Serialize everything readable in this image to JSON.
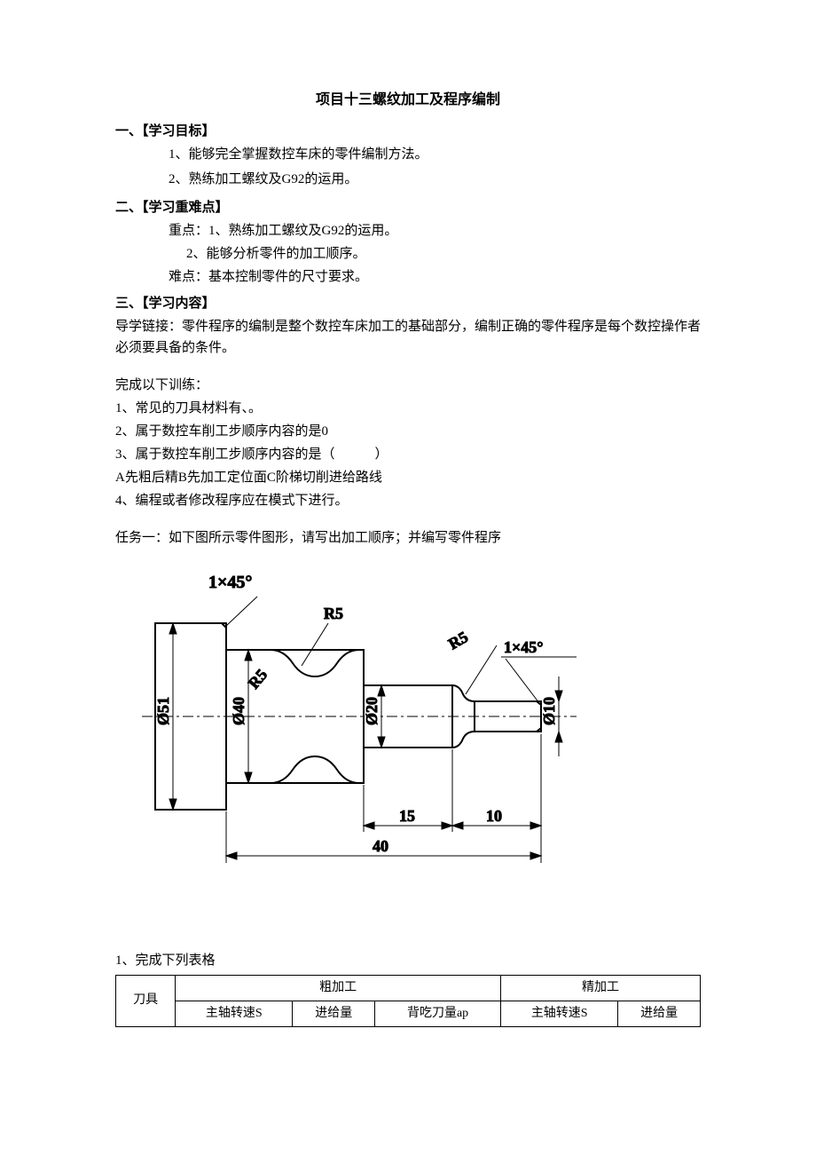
{
  "title": "项目十三螺纹加工及程序编制",
  "s1": {
    "heading": "一、【学习目标】",
    "l1": "1、能够完全掌握数控车床的零件编制方法。",
    "l2": "2、熟练加工螺纹及G92的运用。"
  },
  "s2": {
    "heading": "二、【学习重难点】",
    "l1": "重点：1、熟练加工螺纹及G92的运用。",
    "l2": "2、能够分析零件的加工顺序。",
    "l3": "难点：基本控制零件的尺寸要求。"
  },
  "s3": {
    "heading": "三、【学习内容】",
    "l1": "导学链接：零件程序的编制是整个数控车床加工的基础部分，编制正确的零件程序是每个数控操作者必须要具备的条件。",
    "pre": "完成以下训练：",
    "q1": "1、常见的刀具材料有、。",
    "q2": "2、属于数控车削工步顺序内容的是0",
    "q3": "3、属于数控车削工步顺序内容的是（　　　）",
    "q3o": "A先粗后精B先加工定位面C阶梯切削进给路线",
    "q4": "4、编程或者修改程序应在模式下进行。",
    "task1": "任务一：如下图所示零件图形，请写出加工顺序；并编写零件程序"
  },
  "diagram": {
    "chamfer1": "1×45°",
    "chamfer2": "1×45°",
    "r1": "R5",
    "r2": "R5",
    "r3": "R5",
    "d51": "Ø51",
    "d40": "Ø40",
    "d20": "Ø20",
    "d10": "Ø10",
    "len15": "15",
    "len10": "10",
    "len40": "40"
  },
  "table": {
    "caption": "1、完成下列表格",
    "h_rough": "粗加工",
    "h_fine": "精加工",
    "h_tool": "刀具",
    "h_speed1": "主轴转速S",
    "h_feed1": "进给量",
    "h_ap": "背吃刀量ap",
    "h_speed2": "主轴转速S",
    "h_feed2": "进给量"
  }
}
